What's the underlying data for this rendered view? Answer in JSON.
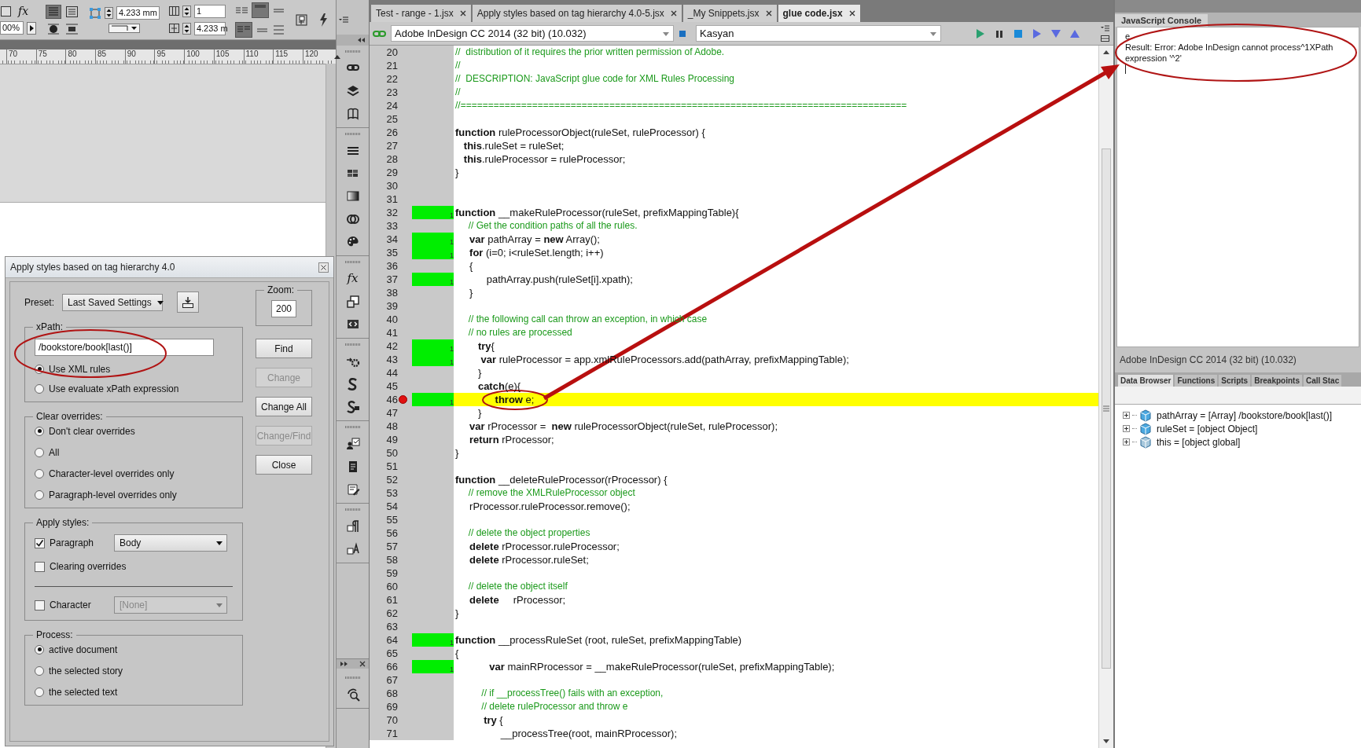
{
  "toolbar": {
    "effects_label": "fx",
    "zoom": "00%",
    "stroke_weight": "4.233 mm",
    "columns": "1",
    "gutter": "4.233 m"
  },
  "ruler": {
    "labels": [
      "70",
      "75",
      "80",
      "85",
      "90",
      "95",
      "100",
      "105",
      "110",
      "115",
      "120"
    ]
  },
  "dialog": {
    "title": "Apply styles based on tag hierarchy 4.0",
    "preset": {
      "label": "Preset:",
      "value": "Last Saved Settings"
    },
    "zoom": {
      "label": "Zoom:",
      "value": "200"
    },
    "xpath": {
      "label": "xPath:",
      "value": "/bookstore/book[last()]",
      "options": [
        {
          "label": "Use XML rules",
          "selected": true
        },
        {
          "label": "Use evaluate xPath expression",
          "selected": false
        }
      ]
    },
    "clear_overrides": {
      "label": "Clear overrides:",
      "options": [
        {
          "label": "Don't clear overrides",
          "selected": true
        },
        {
          "label": "All",
          "selected": false
        },
        {
          "label": "Character-level overrides only",
          "selected": false
        },
        {
          "label": "Paragraph-level overrides only",
          "selected": false
        }
      ]
    },
    "apply_styles": {
      "label": "Apply styles:",
      "items": [
        {
          "label": "Paragraph",
          "checked": true,
          "style": "Body",
          "style_disabled": false
        },
        {
          "label": "Clearing overrides",
          "checked": false
        },
        {
          "label": "Character",
          "checked": false,
          "style": "[None]",
          "style_disabled": true
        }
      ]
    },
    "process": {
      "label": "Process:",
      "options": [
        {
          "label": "active document",
          "selected": true
        },
        {
          "label": "the selected story",
          "selected": false
        },
        {
          "label": "the selected text",
          "selected": false
        }
      ]
    },
    "buttons": [
      {
        "label": "Find",
        "disabled": false
      },
      {
        "label": "Change",
        "disabled": true
      },
      {
        "label": "Change All",
        "disabled": false
      },
      {
        "label": "Change/Find",
        "disabled": true
      },
      {
        "label": "Close",
        "disabled": false
      }
    ]
  },
  "icon_panel": {
    "effects_label": "fx"
  },
  "editor": {
    "tabs": [
      {
        "label": "Test - range - 1.jsx",
        "selected": false
      },
      {
        "label": "Apply styles based on tag hierarchy 4.0-5.jsx",
        "selected": false
      },
      {
        "label": "_My Snippets.jsx",
        "selected": false
      },
      {
        "label": "glue code.jsx",
        "selected": true
      }
    ],
    "target": "Adobe InDesign CC 2014 (32 bit) (10.032)",
    "engine": "Kasyan",
    "lines": [
      {
        "number": "20",
        "kind": "comment",
        "text": "//  distribution of it requires the prior written permission of Adobe.",
        "covered": false,
        "breakpoint": false,
        "current": false
      },
      {
        "number": "21",
        "kind": "comment",
        "text": "//",
        "covered": false,
        "breakpoint": false,
        "current": false
      },
      {
        "number": "22",
        "kind": "comment",
        "text": "//  DESCRIPTION: JavaScript glue code for XML Rules Processing",
        "covered": false,
        "breakpoint": false,
        "current": false
      },
      {
        "number": "23",
        "kind": "comment",
        "text": "//",
        "covered": false,
        "breakpoint": false,
        "current": false
      },
      {
        "number": "24",
        "kind": "comment",
        "text": "//=================================================================================",
        "covered": false,
        "breakpoint": false,
        "current": false
      },
      {
        "number": "25",
        "kind": "blank",
        "covered": false,
        "breakpoint": false,
        "current": false
      },
      {
        "number": "26",
        "kind": "code",
        "text": "**function** ruleProcessorObject(ruleSet, ruleProcessor) {",
        "covered": false,
        "breakpoint": false,
        "current": false
      },
      {
        "number": "27",
        "kind": "code",
        "text": "   **this**.ruleSet = ruleSet;",
        "covered": false,
        "breakpoint": false,
        "current": false
      },
      {
        "number": "28",
        "kind": "code",
        "text": "   **this**.ruleProcessor = ruleProcessor;",
        "covered": false,
        "breakpoint": false,
        "current": false
      },
      {
        "number": "29",
        "kind": "code",
        "text": "}",
        "covered": false,
        "breakpoint": false,
        "current": false
      },
      {
        "number": "30",
        "kind": "blank",
        "covered": false,
        "breakpoint": false,
        "current": false
      },
      {
        "number": "31",
        "kind": "blank",
        "covered": false,
        "breakpoint": false,
        "current": false
      },
      {
        "number": "32",
        "kind": "code",
        "text": "**function** __makeRuleProcessor(ruleSet, prefixMappingTable){",
        "covered": true,
        "hits": "1",
        "breakpoint": false,
        "current": false
      },
      {
        "number": "33",
        "kind": "comment",
        "text": "     // Get the condition paths of all the rules.",
        "covered": false,
        "breakpoint": false,
        "current": false
      },
      {
        "number": "34",
        "kind": "code",
        "text": "     **var** pathArray = **new** Array();",
        "covered": true,
        "hits": "1",
        "breakpoint": false,
        "current": false
      },
      {
        "number": "35",
        "kind": "code",
        "text": "     **for** (i=0; i<ruleSet.length; i++)",
        "covered": true,
        "hits": "1",
        "breakpoint": false,
        "current": false
      },
      {
        "number": "36",
        "kind": "code",
        "text": "     {",
        "covered": false,
        "breakpoint": false,
        "current": false
      },
      {
        "number": "37",
        "kind": "code",
        "text": "           pathArray.push(ruleSet[i].xpath);",
        "covered": true,
        "hits": "1",
        "breakpoint": false,
        "current": false
      },
      {
        "number": "38",
        "kind": "code",
        "text": "     }",
        "covered": false,
        "breakpoint": false,
        "current": false
      },
      {
        "number": "39",
        "kind": "blank",
        "covered": false,
        "breakpoint": false,
        "current": false
      },
      {
        "number": "40",
        "kind": "comment",
        "text": "     // the following call can throw an exception, in which case",
        "covered": false,
        "breakpoint": false,
        "current": false
      },
      {
        "number": "41",
        "kind": "comment",
        "text": "     // no rules are processed",
        "covered": false,
        "breakpoint": false,
        "current": false
      },
      {
        "number": "42",
        "kind": "code",
        "text": "        **try**{",
        "covered": true,
        "hits": "1",
        "breakpoint": false,
        "current": false
      },
      {
        "number": "43",
        "kind": "code",
        "text": "         **var** ruleProcessor = app.xmlRuleProcessors.add(pathArray, prefixMappingTable);",
        "covered": true,
        "hits": "1",
        "breakpoint": false,
        "current": false
      },
      {
        "number": "44",
        "kind": "code",
        "text": "        }",
        "covered": false,
        "breakpoint": false,
        "current": false
      },
      {
        "number": "45",
        "kind": "code",
        "text": "        **catch**(e){",
        "covered": false,
        "breakpoint": false,
        "current": false
      },
      {
        "number": "46",
        "kind": "code",
        "text": "              **throw** e;",
        "covered": true,
        "hits": "1",
        "breakpoint": true,
        "current": true
      },
      {
        "number": "47",
        "kind": "code",
        "text": "        }",
        "covered": false,
        "breakpoint": false,
        "current": false
      },
      {
        "number": "48",
        "kind": "code",
        "text": "     **var** rProcessor =  **new** ruleProcessorObject(ruleSet, ruleProcessor);",
        "covered": false,
        "breakpoint": false,
        "current": false
      },
      {
        "number": "49",
        "kind": "code",
        "text": "     **return** rProcessor;",
        "covered": false,
        "breakpoint": false,
        "current": false
      },
      {
        "number": "50",
        "kind": "code",
        "text": "}",
        "covered": false,
        "breakpoint": false,
        "current": false
      },
      {
        "number": "51",
        "kind": "blank",
        "covered": false,
        "breakpoint": false,
        "current": false
      },
      {
        "number": "52",
        "kind": "code",
        "text": "**function** __deleteRuleProcessor(rProcessor) {",
        "covered": false,
        "breakpoint": false,
        "current": false
      },
      {
        "number": "53",
        "kind": "comment",
        "text": "     // remove the XMLRuleProcessor object",
        "covered": false,
        "breakpoint": false,
        "current": false
      },
      {
        "number": "54",
        "kind": "code",
        "text": "     rProcessor.ruleProcessor.remove();",
        "covered": false,
        "breakpoint": false,
        "current": false
      },
      {
        "number": "55",
        "kind": "blank",
        "covered": false,
        "breakpoint": false,
        "current": false
      },
      {
        "number": "56",
        "kind": "comment",
        "text": "     // delete the object properties",
        "covered": false,
        "breakpoint": false,
        "current": false
      },
      {
        "number": "57",
        "kind": "code",
        "text": "     **delete** rProcessor.ruleProcessor;",
        "covered": false,
        "breakpoint": false,
        "current": false
      },
      {
        "number": "58",
        "kind": "code",
        "text": "     **delete** rProcessor.ruleSet;",
        "covered": false,
        "breakpoint": false,
        "current": false
      },
      {
        "number": "59",
        "kind": "blank",
        "covered": false,
        "breakpoint": false,
        "current": false
      },
      {
        "number": "60",
        "kind": "comment",
        "text": "     // delete the object itself",
        "covered": false,
        "breakpoint": false,
        "current": false
      },
      {
        "number": "61",
        "kind": "code",
        "text": "     **delete**     rProcessor;",
        "covered": false,
        "breakpoint": false,
        "current": false
      },
      {
        "number": "62",
        "kind": "code",
        "text": "}",
        "covered": false,
        "breakpoint": false,
        "current": false
      },
      {
        "number": "63",
        "kind": "blank",
        "covered": false,
        "breakpoint": false,
        "current": false
      },
      {
        "number": "64",
        "kind": "code",
        "text": "**function** __processRuleSet (root, ruleSet, prefixMappingTable)",
        "covered": true,
        "hits": "1",
        "breakpoint": false,
        "current": false
      },
      {
        "number": "65",
        "kind": "code",
        "text": "{",
        "covered": false,
        "breakpoint": false,
        "current": false
      },
      {
        "number": "66",
        "kind": "code",
        "text": "            **var** mainRProcessor = __makeRuleProcessor(ruleSet, prefixMappingTable);",
        "covered": true,
        "hits": "1",
        "breakpoint": false,
        "current": false
      },
      {
        "number": "67",
        "kind": "blank",
        "covered": false,
        "breakpoint": false,
        "current": false
      },
      {
        "number": "68",
        "kind": "comment",
        "text": "          // if __processTree() fails with an exception,",
        "covered": false,
        "breakpoint": false,
        "current": false
      },
      {
        "number": "69",
        "kind": "comment",
        "text": "          // delete ruleProcessor and throw e",
        "covered": false,
        "breakpoint": false,
        "current": false
      },
      {
        "number": "70",
        "kind": "code",
        "text": "          **try** {",
        "covered": false,
        "breakpoint": false,
        "current": false
      },
      {
        "number": "71",
        "kind": "code",
        "text": "                __processTree(root, mainRProcessor);",
        "covered": false,
        "breakpoint": false,
        "current": false
      }
    ]
  },
  "console": {
    "tab": "JavaScript Console",
    "lines": [
      "e",
      "Result: Error: Adobe InDesign cannot process^1XPath expression '^2'"
    ],
    "status": "Adobe InDesign CC 2014 (32 bit) (10.032)"
  },
  "data_browser": {
    "tabs": [
      {
        "label": "Data Browser",
        "selected": true
      },
      {
        "label": "Functions",
        "selected": false
      },
      {
        "label": "Scripts",
        "selected": false
      },
      {
        "label": "Breakpoints",
        "selected": false
      },
      {
        "label": "Call Stac",
        "selected": false
      }
    ],
    "items": [
      {
        "text": "pathArray = [Array] /bookstore/book[last()]",
        "kind": "object"
      },
      {
        "text": "ruleSet = [object Object]",
        "kind": "object"
      },
      {
        "text": "this = [object global]",
        "kind": "global"
      }
    ]
  }
}
